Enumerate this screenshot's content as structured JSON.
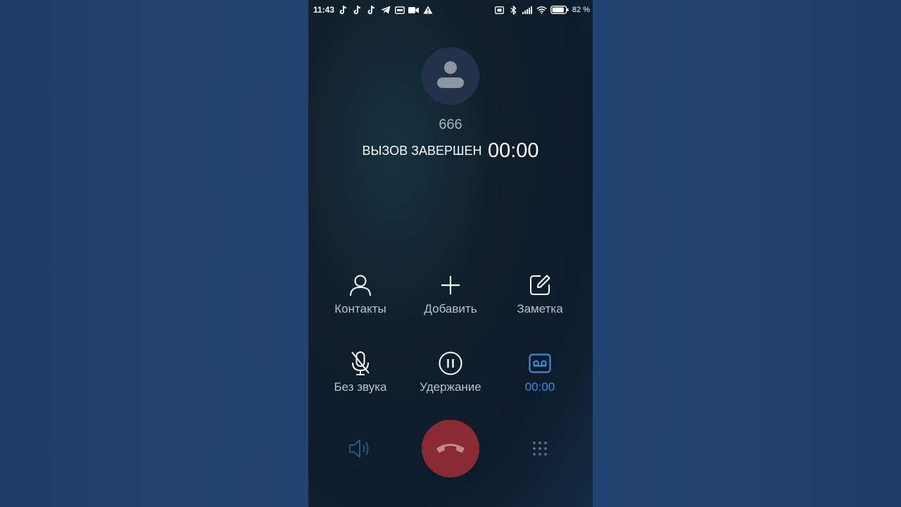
{
  "status_bar": {
    "time": "11:43",
    "notification_icons": [
      "tiktok-icon",
      "tiktok-icon",
      "tiktok-icon",
      "telegram-icon",
      "vpn-icon",
      "video-icon",
      "warning-icon"
    ],
    "system_icons": [
      "nfc-icon",
      "bluetooth-icon",
      "signal-icon",
      "wifi-icon",
      "battery-icon"
    ],
    "battery_percent": "82 %"
  },
  "caller": {
    "avatar_icon": "person-icon",
    "number": "666",
    "call_state": "ВЫЗОВ ЗАВЕРШЕН",
    "timer": "00:00"
  },
  "actions": {
    "contacts": {
      "label": "Контакты",
      "icon": "person-outline-icon"
    },
    "add": {
      "label": "Добавить",
      "icon": "plus-icon"
    },
    "note": {
      "label": "Заметка",
      "icon": "note-edit-icon"
    },
    "mute": {
      "label": "Без звука",
      "icon": "mic-off-icon"
    },
    "hold": {
      "label": "Удержание",
      "icon": "pause-icon"
    },
    "record": {
      "label": "00:00",
      "icon": "voicemail-icon"
    }
  },
  "bottom": {
    "speaker_icon": "speaker-icon",
    "end_call_icon": "phone-hangup-icon",
    "keypad_icon": "dialpad-icon"
  },
  "colors": {
    "accent": "#3d8bd6",
    "end_call": "#8a2b33",
    "background": "#1f3f6b"
  }
}
